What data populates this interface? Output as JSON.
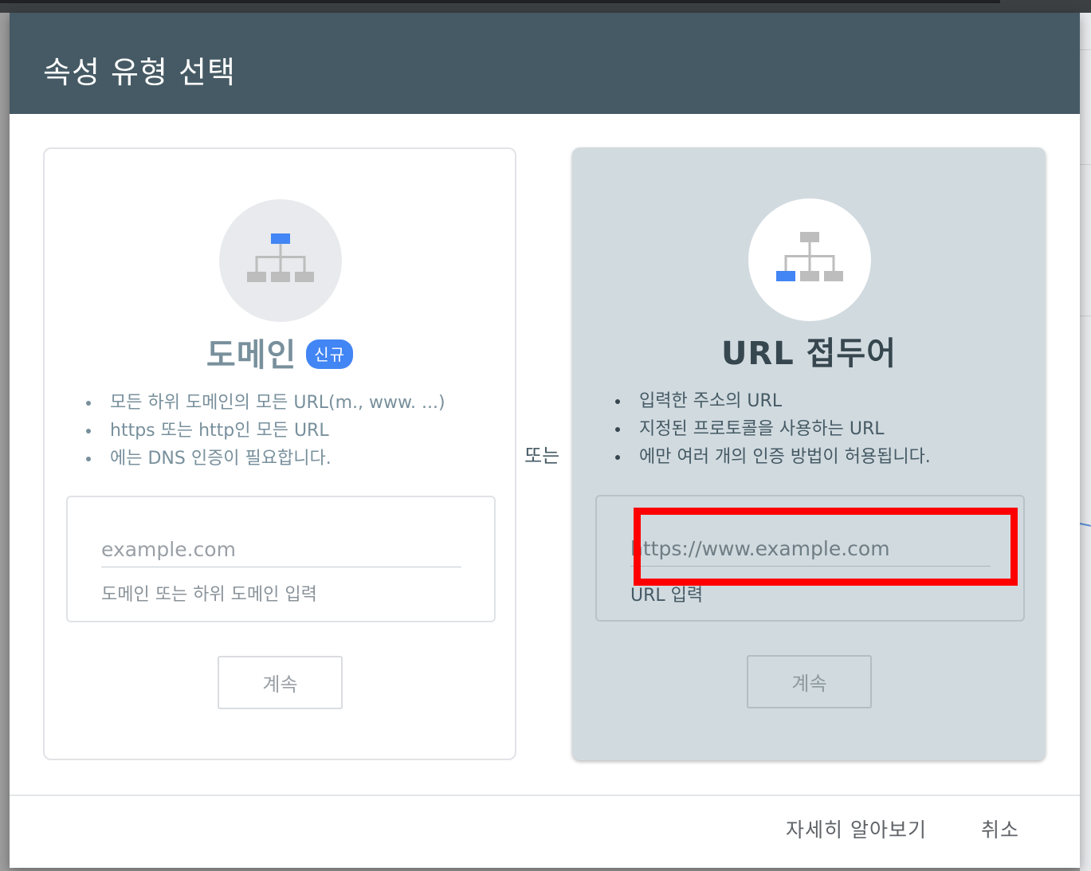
{
  "dialog": {
    "title": "속성 유형 선택"
  },
  "domain_card": {
    "title": "도메인",
    "badge": "신규",
    "bullets": [
      "모든 하위 도메인의 모든 URL(m., www. ...)",
      "https 또는 http인 모든 URL",
      "에는 DNS 인증이 필요합니다."
    ],
    "input_placeholder": "example.com",
    "input_helper": "도메인 또는 하위 도메인 입력",
    "continue_label": "계속",
    "icon": "sitemap-root-highlight-icon"
  },
  "separator": "또는",
  "url_card": {
    "title": "URL 접두어",
    "bullets": [
      "입력한 주소의 URL",
      "지정된 프로토콜을 사용하는 URL",
      "에만 여러 개의 인증 방법이 허용됩니다."
    ],
    "input_placeholder": "https://www.example.com",
    "input_helper": "URL 입력",
    "continue_label": "계속",
    "icon": "sitemap-leaf-highlight-icon"
  },
  "footer": {
    "learn_more_label": "자세히 알아보기",
    "cancel_label": "취소"
  },
  "colors": {
    "header_bg": "#455a64",
    "accent_blue": "#4285f4",
    "highlight_red": "#ff0000",
    "url_card_bg": "#d1dadf"
  }
}
